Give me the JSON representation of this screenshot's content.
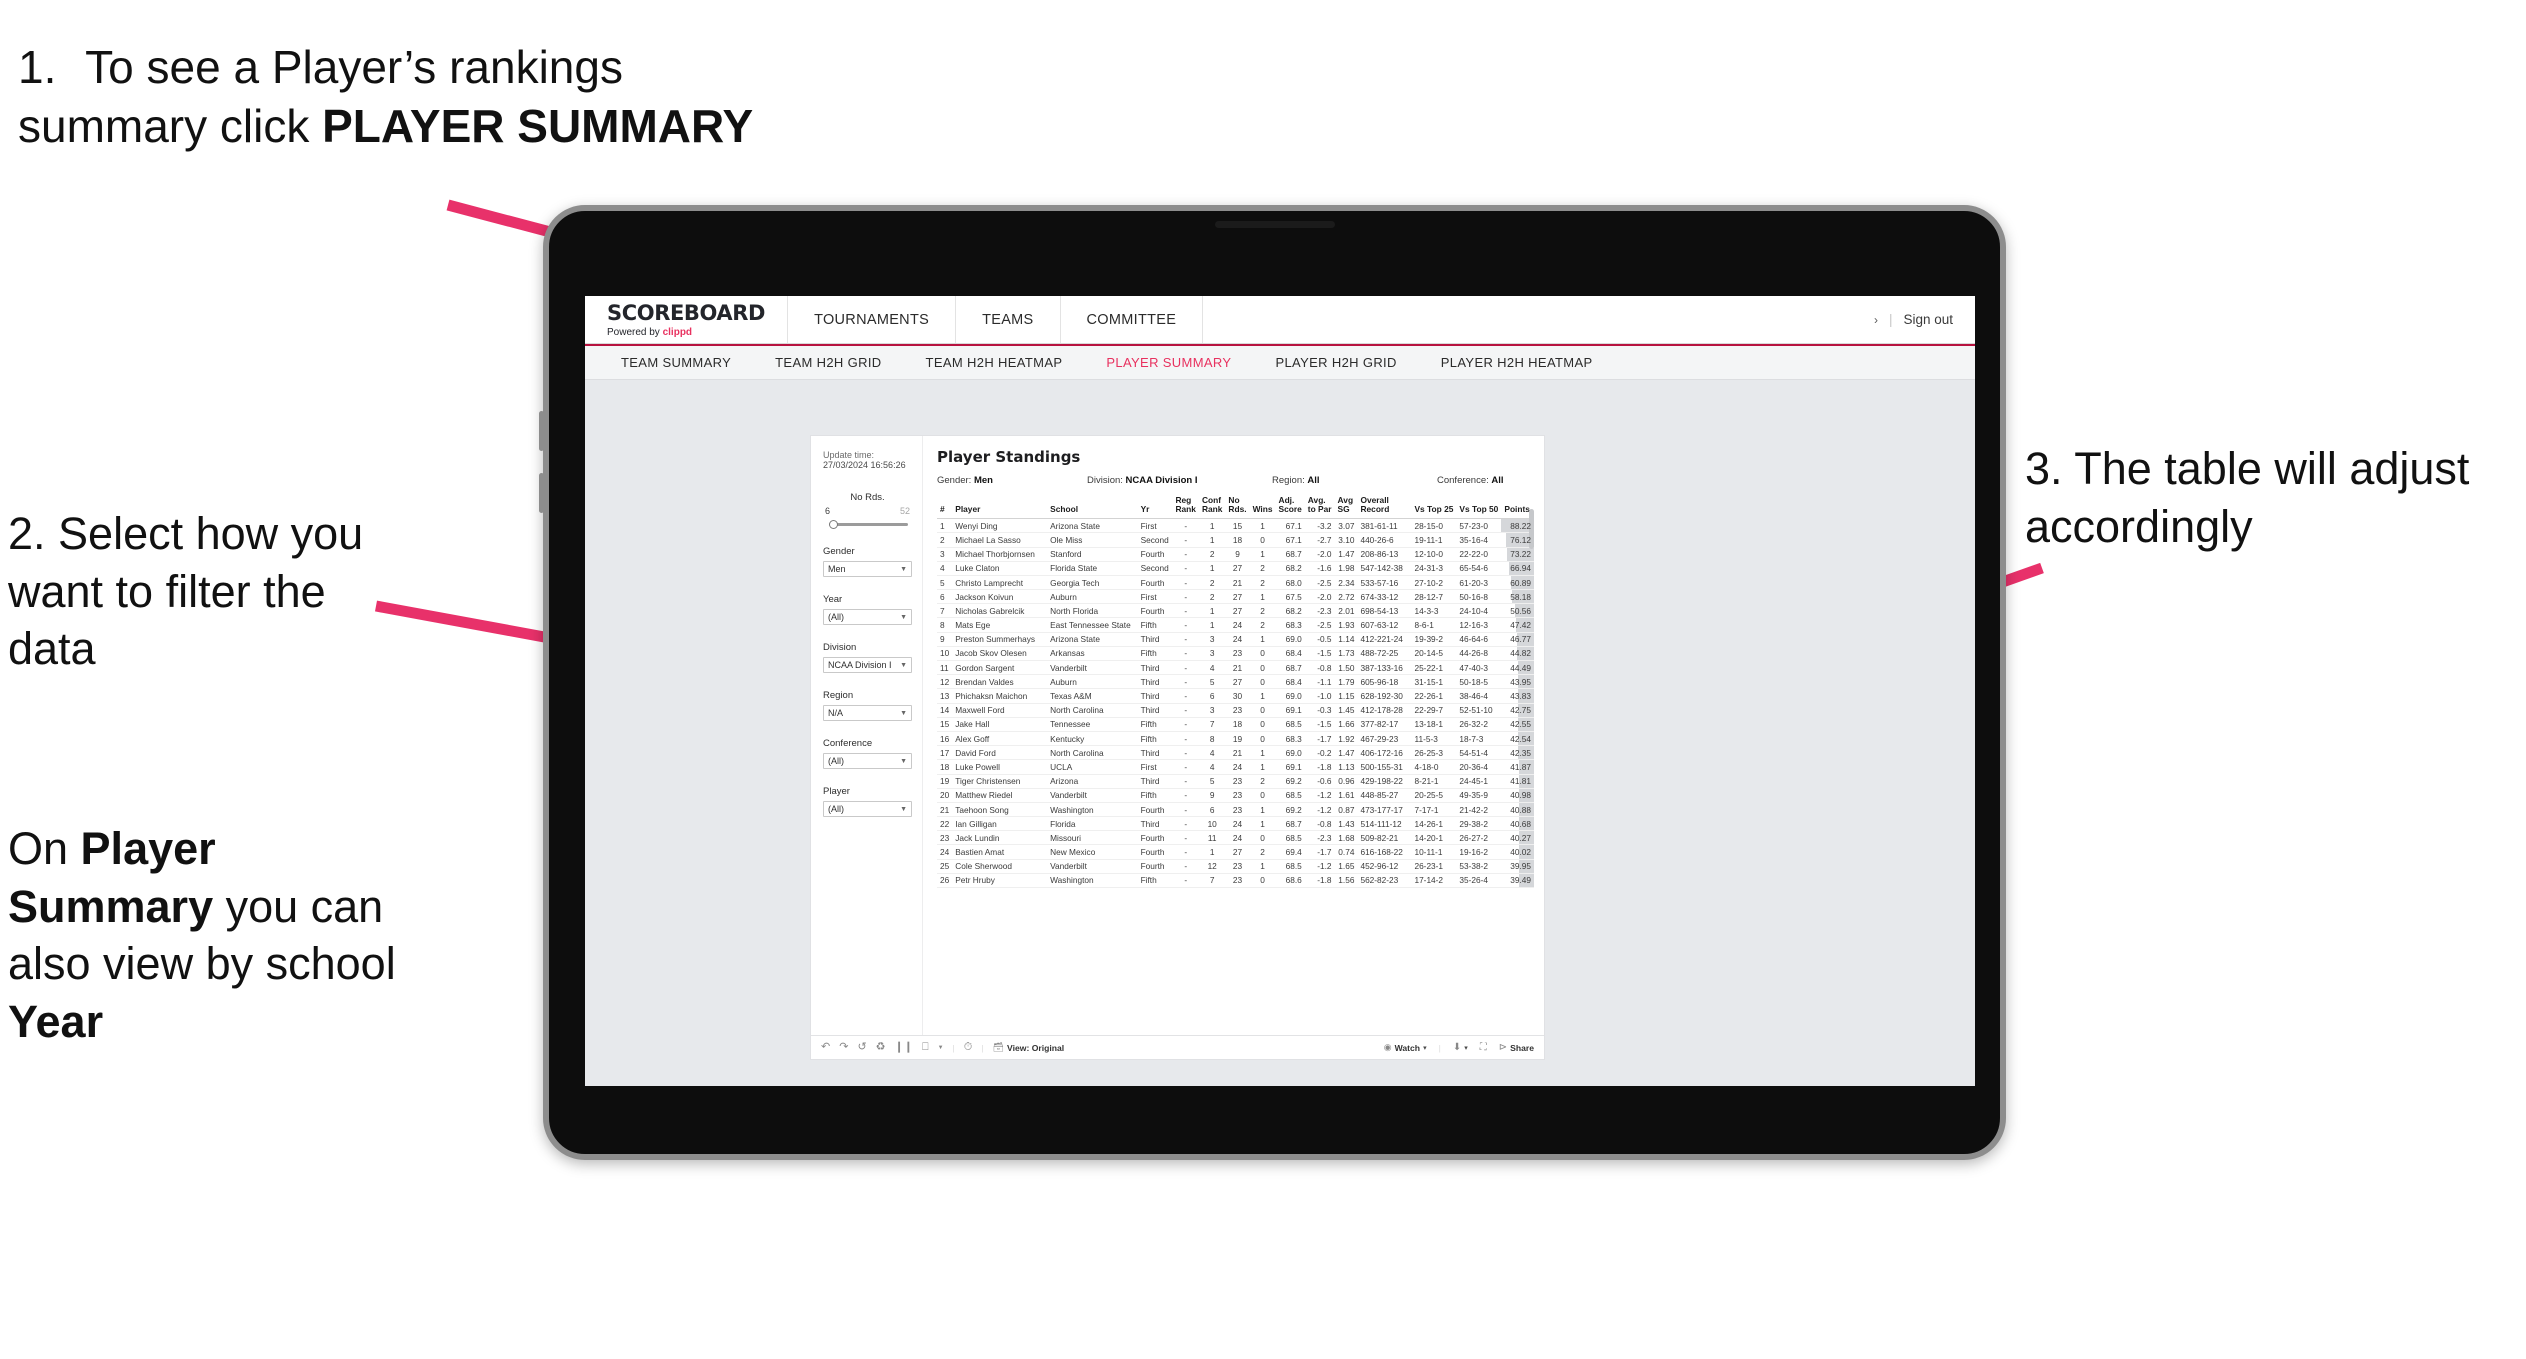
{
  "annotations": {
    "step1_number": "1.",
    "step1_text_a": "To see a Player’s rankings summary click ",
    "step1_bold": "PLAYER SUMMARY",
    "step2": "2. Select how you want to filter the data",
    "step2b_a": "On ",
    "step2b_bold1": "Player Summary",
    "step2b_b": " you can also view by school ",
    "step2b_bold2": "Year",
    "step3": "3. The table will adjust accordingly"
  },
  "app": {
    "brand_title": "SCOREBOARD",
    "brand_sub_prefix": "Powered by ",
    "brand_sub_name": "clippd",
    "top_nav": [
      "TOURNAMENTS",
      "TEAMS",
      "COMMITTEE"
    ],
    "account_chevron": "›",
    "account_sep": "|",
    "sign_out": "Sign out",
    "sub_nav": [
      {
        "label": "TEAM SUMMARY",
        "active": false
      },
      {
        "label": "TEAM H2H GRID",
        "active": false
      },
      {
        "label": "TEAM H2H HEATMAP",
        "active": false
      },
      {
        "label": "PLAYER SUMMARY",
        "active": true
      },
      {
        "label": "PLAYER H2H GRID",
        "active": false
      },
      {
        "label": "PLAYER H2H HEATMAP",
        "active": false
      }
    ],
    "accent_pink": "#e8315f",
    "accent_underline": "#b7123f"
  },
  "viz": {
    "update_label": "Update time:",
    "update_value": "27/03/2024 16:56:26",
    "title": "Player Standings",
    "meta": [
      {
        "label": "Gender:",
        "value": "Men"
      },
      {
        "label": "Division:",
        "value": "NCAA Division I"
      },
      {
        "label": "Region:",
        "value": "All"
      },
      {
        "label": "Conference:",
        "value": "All"
      }
    ],
    "filters": {
      "slider_title": "No Rds.",
      "slider_min": "6",
      "slider_max": "52",
      "controls": [
        {
          "label": "Gender",
          "value": "Men"
        },
        {
          "label": "Year",
          "value": "(All)"
        },
        {
          "label": "Division",
          "value": "NCAA Division I"
        },
        {
          "label": "Region",
          "value": "N/A"
        },
        {
          "label": "Conference",
          "value": "(All)"
        },
        {
          "label": "Player",
          "value": "(All)"
        }
      ]
    },
    "toolbar": {
      "view_label": "View: Original",
      "watch_label": "Watch",
      "share_label": "Share",
      "caret": "▾"
    }
  },
  "table": {
    "columns": [
      {
        "key": "rank",
        "l1": "#",
        "l2": ""
      },
      {
        "key": "player",
        "l1": "Player",
        "l2": ""
      },
      {
        "key": "school",
        "l1": "School",
        "l2": ""
      },
      {
        "key": "yr",
        "l1": "Yr",
        "l2": ""
      },
      {
        "key": "reg_rank",
        "l1": "Reg",
        "l2": "Rank"
      },
      {
        "key": "conf_rank",
        "l1": "Conf",
        "l2": "Rank"
      },
      {
        "key": "no_rds",
        "l1": "No",
        "l2": "Rds."
      },
      {
        "key": "wins",
        "l1": "Wins",
        "l2": ""
      },
      {
        "key": "adj_score",
        "l1": "Adj.",
        "l2": "Score"
      },
      {
        "key": "avg_to_par",
        "l1": "Avg.",
        "l2": "to Par"
      },
      {
        "key": "avg_sg",
        "l1": "Avg",
        "l2": "SG"
      },
      {
        "key": "overall_record",
        "l1": "Overall",
        "l2": "Record"
      },
      {
        "key": "vs_top25",
        "l1": "Vs Top 25",
        "l2": ""
      },
      {
        "key": "vs_top50",
        "l1": "Vs Top 50",
        "l2": ""
      },
      {
        "key": "points",
        "l1": "Points",
        "l2": ""
      }
    ],
    "rows": [
      {
        "rank": "1",
        "player": "Wenyi Ding",
        "school": "Arizona State",
        "yr": "First",
        "reg_rank": "-",
        "conf_rank": "1",
        "no_rds": "15",
        "wins": "1",
        "adj_score": "67.1",
        "avg_to_par": "-3.2",
        "avg_sg": "3.07",
        "overall_record": "381-61-11",
        "vs_top25": "28-15-0",
        "vs_top50": "57-23-0",
        "points": "88.22"
      },
      {
        "rank": "2",
        "player": "Michael La Sasso",
        "school": "Ole Miss",
        "yr": "Second",
        "reg_rank": "-",
        "conf_rank": "1",
        "no_rds": "18",
        "wins": "0",
        "adj_score": "67.1",
        "avg_to_par": "-2.7",
        "avg_sg": "3.10",
        "overall_record": "440-26-6",
        "vs_top25": "19-11-1",
        "vs_top50": "35-16-4",
        "points": "76.12"
      },
      {
        "rank": "3",
        "player": "Michael Thorbjornsen",
        "school": "Stanford",
        "yr": "Fourth",
        "reg_rank": "-",
        "conf_rank": "2",
        "no_rds": "9",
        "wins": "1",
        "adj_score": "68.7",
        "avg_to_par": "-2.0",
        "avg_sg": "1.47",
        "overall_record": "208-86-13",
        "vs_top25": "12-10-0",
        "vs_top50": "22-22-0",
        "points": "73.22"
      },
      {
        "rank": "4",
        "player": "Luke Claton",
        "school": "Florida State",
        "yr": "Second",
        "reg_rank": "-",
        "conf_rank": "1",
        "no_rds": "27",
        "wins": "2",
        "adj_score": "68.2",
        "avg_to_par": "-1.6",
        "avg_sg": "1.98",
        "overall_record": "547-142-38",
        "vs_top25": "24-31-3",
        "vs_top50": "65-54-6",
        "points": "66.94"
      },
      {
        "rank": "5",
        "player": "Christo Lamprecht",
        "school": "Georgia Tech",
        "yr": "Fourth",
        "reg_rank": "-",
        "conf_rank": "2",
        "no_rds": "21",
        "wins": "2",
        "adj_score": "68.0",
        "avg_to_par": "-2.5",
        "avg_sg": "2.34",
        "overall_record": "533-57-16",
        "vs_top25": "27-10-2",
        "vs_top50": "61-20-3",
        "points": "60.89"
      },
      {
        "rank": "6",
        "player": "Jackson Koivun",
        "school": "Auburn",
        "yr": "First",
        "reg_rank": "-",
        "conf_rank": "2",
        "no_rds": "27",
        "wins": "1",
        "adj_score": "67.5",
        "avg_to_par": "-2.0",
        "avg_sg": "2.72",
        "overall_record": "674-33-12",
        "vs_top25": "28-12-7",
        "vs_top50": "50-16-8",
        "points": "58.18"
      },
      {
        "rank": "7",
        "player": "Nicholas Gabrelcik",
        "school": "North Florida",
        "yr": "Fourth",
        "reg_rank": "-",
        "conf_rank": "1",
        "no_rds": "27",
        "wins": "2",
        "adj_score": "68.2",
        "avg_to_par": "-2.3",
        "avg_sg": "2.01",
        "overall_record": "698-54-13",
        "vs_top25": "14-3-3",
        "vs_top50": "24-10-4",
        "points": "50.56"
      },
      {
        "rank": "8",
        "player": "Mats Ege",
        "school": "East Tennessee State",
        "yr": "Fifth",
        "reg_rank": "-",
        "conf_rank": "1",
        "no_rds": "24",
        "wins": "2",
        "adj_score": "68.3",
        "avg_to_par": "-2.5",
        "avg_sg": "1.93",
        "overall_record": "607-63-12",
        "vs_top25": "8-6-1",
        "vs_top50": "12-16-3",
        "points": "47.42"
      },
      {
        "rank": "9",
        "player": "Preston Summerhays",
        "school": "Arizona State",
        "yr": "Third",
        "reg_rank": "-",
        "conf_rank": "3",
        "no_rds": "24",
        "wins": "1",
        "adj_score": "69.0",
        "avg_to_par": "-0.5",
        "avg_sg": "1.14",
        "overall_record": "412-221-24",
        "vs_top25": "19-39-2",
        "vs_top50": "46-64-6",
        "points": "46.77"
      },
      {
        "rank": "10",
        "player": "Jacob Skov Olesen",
        "school": "Arkansas",
        "yr": "Fifth",
        "reg_rank": "-",
        "conf_rank": "3",
        "no_rds": "23",
        "wins": "0",
        "adj_score": "68.4",
        "avg_to_par": "-1.5",
        "avg_sg": "1.73",
        "overall_record": "488-72-25",
        "vs_top25": "20-14-5",
        "vs_top50": "44-26-8",
        "points": "44.82"
      },
      {
        "rank": "11",
        "player": "Gordon Sargent",
        "school": "Vanderbilt",
        "yr": "Third",
        "reg_rank": "-",
        "conf_rank": "4",
        "no_rds": "21",
        "wins": "0",
        "adj_score": "68.7",
        "avg_to_par": "-0.8",
        "avg_sg": "1.50",
        "overall_record": "387-133-16",
        "vs_top25": "25-22-1",
        "vs_top50": "47-40-3",
        "points": "44.49"
      },
      {
        "rank": "12",
        "player": "Brendan Valdes",
        "school": "Auburn",
        "yr": "Third",
        "reg_rank": "-",
        "conf_rank": "5",
        "no_rds": "27",
        "wins": "0",
        "adj_score": "68.4",
        "avg_to_par": "-1.1",
        "avg_sg": "1.79",
        "overall_record": "605-96-18",
        "vs_top25": "31-15-1",
        "vs_top50": "50-18-5",
        "points": "43.95"
      },
      {
        "rank": "13",
        "player": "Phichaksn Maichon",
        "school": "Texas A&M",
        "yr": "Third",
        "reg_rank": "-",
        "conf_rank": "6",
        "no_rds": "30",
        "wins": "1",
        "adj_score": "69.0",
        "avg_to_par": "-1.0",
        "avg_sg": "1.15",
        "overall_record": "628-192-30",
        "vs_top25": "22-26-1",
        "vs_top50": "38-46-4",
        "points": "43.83"
      },
      {
        "rank": "14",
        "player": "Maxwell Ford",
        "school": "North Carolina",
        "yr": "Third",
        "reg_rank": "-",
        "conf_rank": "3",
        "no_rds": "23",
        "wins": "0",
        "adj_score": "69.1",
        "avg_to_par": "-0.3",
        "avg_sg": "1.45",
        "overall_record": "412-178-28",
        "vs_top25": "22-29-7",
        "vs_top50": "52-51-10",
        "points": "42.75"
      },
      {
        "rank": "15",
        "player": "Jake Hall",
        "school": "Tennessee",
        "yr": "Fifth",
        "reg_rank": "-",
        "conf_rank": "7",
        "no_rds": "18",
        "wins": "0",
        "adj_score": "68.5",
        "avg_to_par": "-1.5",
        "avg_sg": "1.66",
        "overall_record": "377-82-17",
        "vs_top25": "13-18-1",
        "vs_top50": "26-32-2",
        "points": "42.55"
      },
      {
        "rank": "16",
        "player": "Alex Goff",
        "school": "Kentucky",
        "yr": "Fifth",
        "reg_rank": "-",
        "conf_rank": "8",
        "no_rds": "19",
        "wins": "0",
        "adj_score": "68.3",
        "avg_to_par": "-1.7",
        "avg_sg": "1.92",
        "overall_record": "467-29-23",
        "vs_top25": "11-5-3",
        "vs_top50": "18-7-3",
        "points": "42.54"
      },
      {
        "rank": "17",
        "player": "David Ford",
        "school": "North Carolina",
        "yr": "Third",
        "reg_rank": "-",
        "conf_rank": "4",
        "no_rds": "21",
        "wins": "1",
        "adj_score": "69.0",
        "avg_to_par": "-0.2",
        "avg_sg": "1.47",
        "overall_record": "406-172-16",
        "vs_top25": "26-25-3",
        "vs_top50": "54-51-4",
        "points": "42.35"
      },
      {
        "rank": "18",
        "player": "Luke Powell",
        "school": "UCLA",
        "yr": "First",
        "reg_rank": "-",
        "conf_rank": "4",
        "no_rds": "24",
        "wins": "1",
        "adj_score": "69.1",
        "avg_to_par": "-1.8",
        "avg_sg": "1.13",
        "overall_record": "500-155-31",
        "vs_top25": "4-18-0",
        "vs_top50": "20-36-4",
        "points": "41.87"
      },
      {
        "rank": "19",
        "player": "Tiger Christensen",
        "school": "Arizona",
        "yr": "Third",
        "reg_rank": "-",
        "conf_rank": "5",
        "no_rds": "23",
        "wins": "2",
        "adj_score": "69.2",
        "avg_to_par": "-0.6",
        "avg_sg": "0.96",
        "overall_record": "429-198-22",
        "vs_top25": "8-21-1",
        "vs_top50": "24-45-1",
        "points": "41.81"
      },
      {
        "rank": "20",
        "player": "Matthew Riedel",
        "school": "Vanderbilt",
        "yr": "Fifth",
        "reg_rank": "-",
        "conf_rank": "9",
        "no_rds": "23",
        "wins": "0",
        "adj_score": "68.5",
        "avg_to_par": "-1.2",
        "avg_sg": "1.61",
        "overall_record": "448-85-27",
        "vs_top25": "20-25-5",
        "vs_top50": "49-35-9",
        "points": "40.98"
      },
      {
        "rank": "21",
        "player": "Taehoon Song",
        "school": "Washington",
        "yr": "Fourth",
        "reg_rank": "-",
        "conf_rank": "6",
        "no_rds": "23",
        "wins": "1",
        "adj_score": "69.2",
        "avg_to_par": "-1.2",
        "avg_sg": "0.87",
        "overall_record": "473-177-17",
        "vs_top25": "7-17-1",
        "vs_top50": "21-42-2",
        "points": "40.88"
      },
      {
        "rank": "22",
        "player": "Ian Gilligan",
        "school": "Florida",
        "yr": "Third",
        "reg_rank": "-",
        "conf_rank": "10",
        "no_rds": "24",
        "wins": "1",
        "adj_score": "68.7",
        "avg_to_par": "-0.8",
        "avg_sg": "1.43",
        "overall_record": "514-111-12",
        "vs_top25": "14-26-1",
        "vs_top50": "29-38-2",
        "points": "40.68"
      },
      {
        "rank": "23",
        "player": "Jack Lundin",
        "school": "Missouri",
        "yr": "Fourth",
        "reg_rank": "-",
        "conf_rank": "11",
        "no_rds": "24",
        "wins": "0",
        "adj_score": "68.5",
        "avg_to_par": "-2.3",
        "avg_sg": "1.68",
        "overall_record": "509-82-21",
        "vs_top25": "14-20-1",
        "vs_top50": "26-27-2",
        "points": "40.27"
      },
      {
        "rank": "24",
        "player": "Bastien Amat",
        "school": "New Mexico",
        "yr": "Fourth",
        "reg_rank": "-",
        "conf_rank": "1",
        "no_rds": "27",
        "wins": "2",
        "adj_score": "69.4",
        "avg_to_par": "-1.7",
        "avg_sg": "0.74",
        "overall_record": "616-168-22",
        "vs_top25": "10-11-1",
        "vs_top50": "19-16-2",
        "points": "40.02"
      },
      {
        "rank": "25",
        "player": "Cole Sherwood",
        "school": "Vanderbilt",
        "yr": "Fourth",
        "reg_rank": "-",
        "conf_rank": "12",
        "no_rds": "23",
        "wins": "1",
        "adj_score": "68.5",
        "avg_to_par": "-1.2",
        "avg_sg": "1.65",
        "overall_record": "452-96-12",
        "vs_top25": "26-23-1",
        "vs_top50": "53-38-2",
        "points": "39.95"
      },
      {
        "rank": "26",
        "player": "Petr Hruby",
        "school": "Washington",
        "yr": "Fifth",
        "reg_rank": "-",
        "conf_rank": "7",
        "no_rds": "23",
        "wins": "0",
        "adj_score": "68.6",
        "avg_to_par": "-1.8",
        "avg_sg": "1.56",
        "overall_record": "562-82-23",
        "vs_top25": "17-14-2",
        "vs_top50": "35-26-4",
        "points": "39.49"
      }
    ]
  }
}
